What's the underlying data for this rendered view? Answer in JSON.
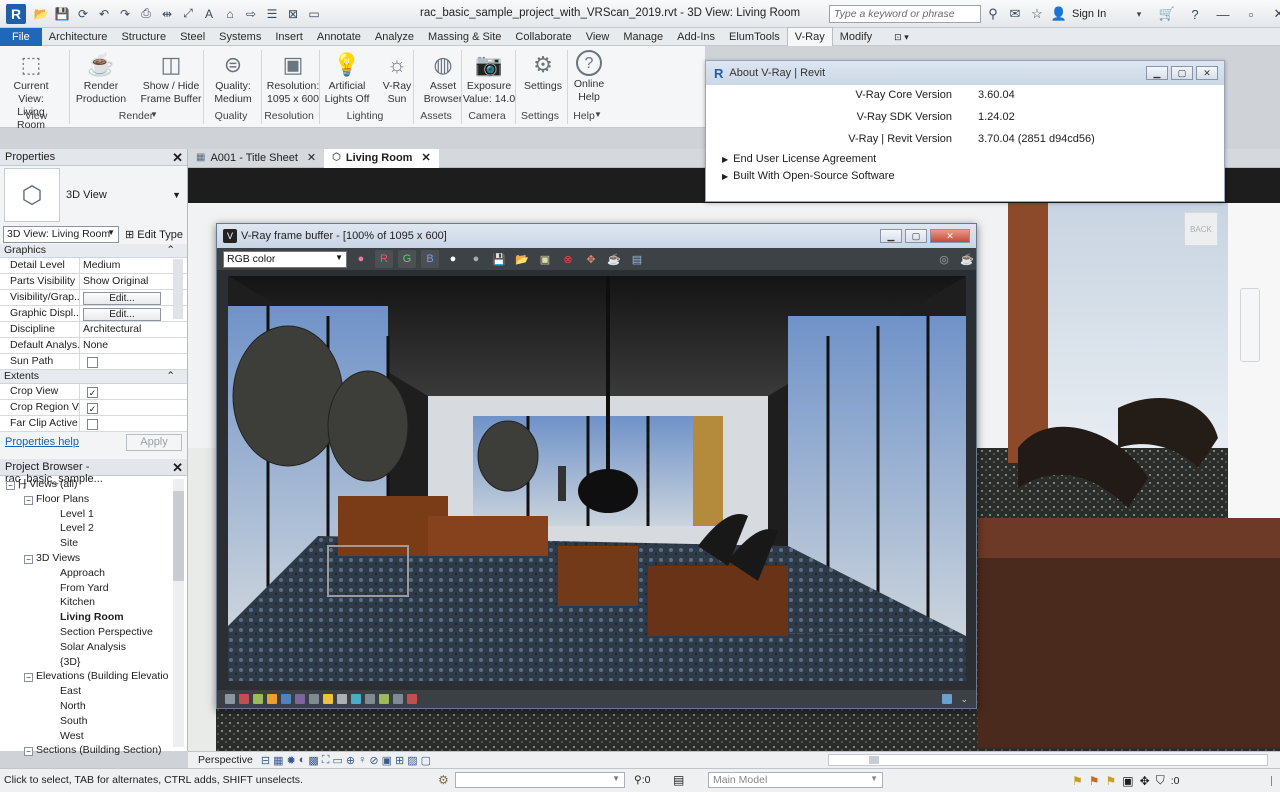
{
  "app": {
    "doc_title": "rac_basic_sample_project_with_VRScan_2019.rvt - 3D View: Living Room",
    "search_placeholder": "Type a keyword or phrase",
    "sign_in": "Sign In"
  },
  "tabs": [
    "File",
    "Architecture",
    "Structure",
    "Steel",
    "Systems",
    "Insert",
    "Annotate",
    "Analyze",
    "Massing & Site",
    "Collaborate",
    "View",
    "Manage",
    "Add-Ins",
    "ElumTools",
    "V-Ray",
    "Modify"
  ],
  "ribbon": {
    "buttons": [
      {
        "l1": "Current View:",
        "l2": "Living Room",
        "icon": "current-view-icon"
      },
      {
        "l1": "Render",
        "l2": "Production",
        "icon": "teapot-icon"
      },
      {
        "l1": "Show / Hide",
        "l2": "Frame Buffer",
        "icon": "frame-buffer-icon"
      },
      {
        "l1": "Quality:",
        "l2": "Medium",
        "icon": "quality-icon"
      },
      {
        "l1": "Resolution:",
        "l2": "1095 x 600",
        "icon": "resolution-icon"
      },
      {
        "l1": "Artificial",
        "l2": "Lights Off",
        "icon": "lightbulb-icon"
      },
      {
        "l1": "V-Ray",
        "l2": "Sun",
        "icon": "sun-icon"
      },
      {
        "l1": "Asset",
        "l2": "Browser",
        "icon": "asset-browser-icon"
      },
      {
        "l1": "Exposure",
        "l2": "Value: 14.0",
        "icon": "camera-icon"
      },
      {
        "l1": "Settings",
        "l2": "",
        "icon": "gear-icon"
      },
      {
        "l1": "Online",
        "l2": "Help",
        "icon": "help-icon"
      }
    ],
    "groups": [
      "View",
      "Render",
      "Quality",
      "Resolution",
      "Lighting",
      "Assets",
      "Camera",
      "Settings",
      "Help"
    ]
  },
  "properties": {
    "title": "Properties",
    "type": "3D View",
    "selector": "3D View: Living Room",
    "edit_type": "Edit Type",
    "graphics": "Graphics",
    "extents": "Extents",
    "rows": [
      [
        "Detail Level",
        "Medium"
      ],
      [
        "Parts Visibility",
        "Show Original"
      ],
      [
        "Visibility/Grap...",
        "Edit..."
      ],
      [
        "Graphic Displ...",
        "Edit..."
      ],
      [
        "Discipline",
        "Architectural"
      ],
      [
        "Default Analys...",
        "None"
      ],
      [
        "Sun Path",
        ""
      ]
    ],
    "ext_rows": [
      [
        "Crop View",
        "✓"
      ],
      [
        "Crop Region V...",
        "✓"
      ],
      [
        "Far Clip Active",
        ""
      ]
    ],
    "help": "Properties help",
    "apply": "Apply"
  },
  "browser": {
    "title": "Project Browser - rac_basic_sample...",
    "items": [
      {
        "t": "Views (all)",
        "lvl": 0,
        "tg": "−"
      },
      {
        "t": "Floor Plans",
        "lvl": 1,
        "tg": "−"
      },
      {
        "t": "Level 1",
        "lvl": 2
      },
      {
        "t": "Level 2",
        "lvl": 2
      },
      {
        "t": "Site",
        "lvl": 2
      },
      {
        "t": "3D Views",
        "lvl": 1,
        "tg": "−"
      },
      {
        "t": "Approach",
        "lvl": 2
      },
      {
        "t": "From Yard",
        "lvl": 2
      },
      {
        "t": "Kitchen",
        "lvl": 2
      },
      {
        "t": "Living Room",
        "lvl": 2,
        "bold": true
      },
      {
        "t": "Section Perspective",
        "lvl": 2
      },
      {
        "t": "Solar Analysis",
        "lvl": 2
      },
      {
        "t": "{3D}",
        "lvl": 2
      },
      {
        "t": "Elevations (Building Elevatio",
        "lvl": 1,
        "tg": "−"
      },
      {
        "t": "East",
        "lvl": 2
      },
      {
        "t": "North",
        "lvl": 2
      },
      {
        "t": "South",
        "lvl": 2
      },
      {
        "t": "West",
        "lvl": 2
      },
      {
        "t": "Sections (Building Section)",
        "lvl": 1,
        "tg": "−"
      }
    ]
  },
  "doctabs": [
    {
      "t": "A001 - Title Sheet"
    },
    {
      "t": "Living Room"
    }
  ],
  "about": {
    "title": "About V-Ray | Revit",
    "rows": [
      [
        "V-Ray Core Version",
        "3.60.04"
      ],
      [
        "V-Ray SDK Version",
        "1.24.02"
      ],
      [
        "V-Ray | Revit Version",
        "3.70.04 (2851 d94cd56)"
      ]
    ],
    "links": [
      "End User License Agreement",
      "Built With Open-Source Software"
    ]
  },
  "vfb": {
    "title": "V-Ray frame buffer - [100% of 1095 x 600]",
    "channel": "RGB color",
    "r": "R",
    "g": "G",
    "b": "B"
  },
  "viewbar": {
    "mode": "Perspective"
  },
  "status": {
    "hint": "Click to select, TAB for alternates, CTRL adds, SHIFT unselects.",
    "count1": ":0",
    "model": "Main Model",
    "count2": ":0"
  },
  "viewcube": "BACK"
}
